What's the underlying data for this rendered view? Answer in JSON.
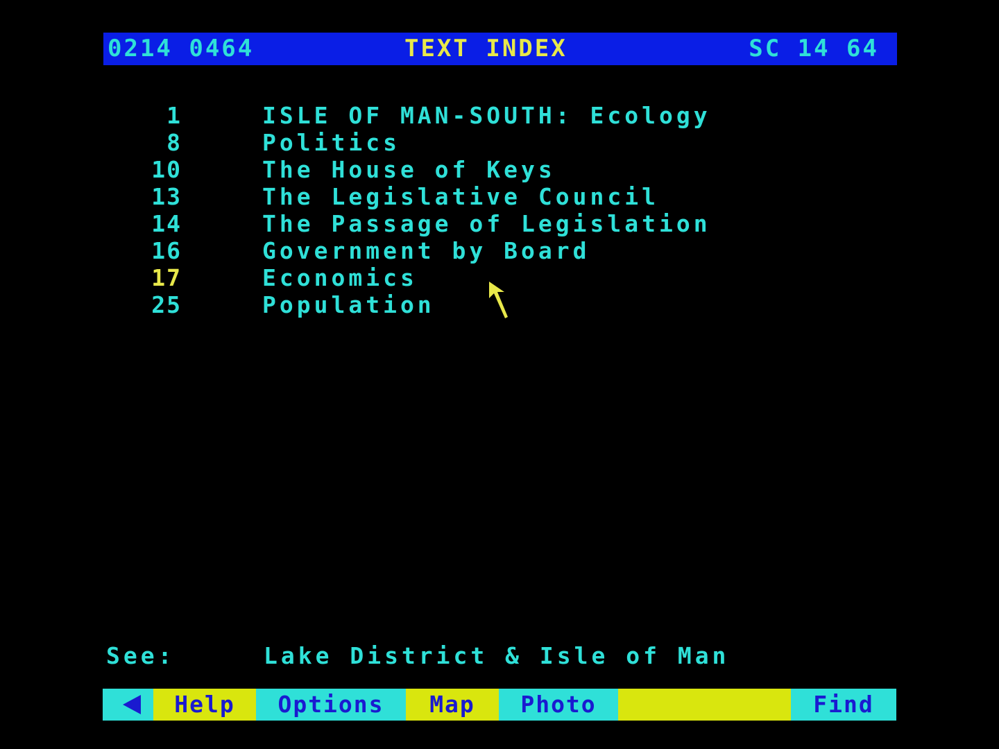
{
  "header": {
    "ref_left": "0214 0464",
    "title": "TEXT INDEX",
    "ref_right": "SC 14 64"
  },
  "index": [
    {
      "page": "1",
      "title": "ISLE OF MAN-SOUTH: Ecology"
    },
    {
      "page": "8",
      "title": "Politics"
    },
    {
      "page": "10",
      "title": "The House of Keys"
    },
    {
      "page": "13",
      "title": "The Legislative Council"
    },
    {
      "page": "14",
      "title": "The Passage of Legislation"
    },
    {
      "page": "16",
      "title": "Government by Board"
    },
    {
      "page": "17",
      "title": "Economics"
    },
    {
      "page": "25",
      "title": "Population"
    }
  ],
  "selected_page": "17",
  "see": {
    "label": "See:",
    "value": "Lake District & Isle of Man"
  },
  "toolbar": {
    "back_icon": "left-arrow-icon",
    "help": "Help",
    "options": "Options",
    "map": "Map",
    "photo": "Photo",
    "blank": "",
    "find": "Find"
  },
  "colors": {
    "background": "#000000",
    "header_bg": "#0a1ee6",
    "text_cyan": "#2fe0d8",
    "text_yellow": "#e8e84a",
    "toolbar_cyan": "#2fe0d8",
    "toolbar_yellow": "#d9e60e",
    "toolbar_text": "#1a1ad0"
  }
}
